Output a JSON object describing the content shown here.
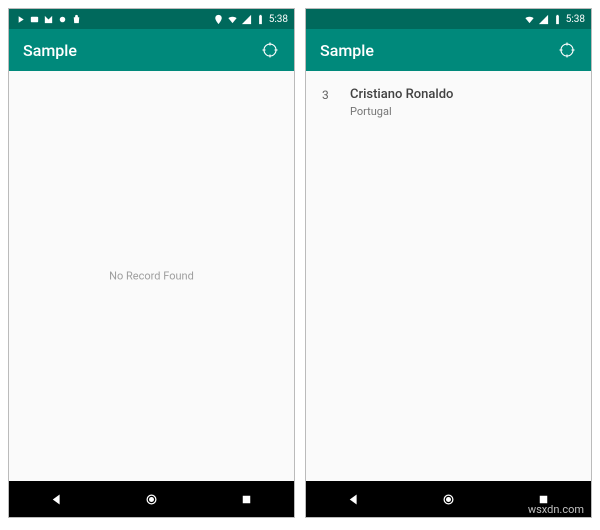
{
  "colors": {
    "primary": "#00897b",
    "primaryDark": "#00695c"
  },
  "status": {
    "time": "5:38"
  },
  "appbar": {
    "title": "Sample"
  },
  "phone1": {
    "emptyMessage": "No Record Found"
  },
  "phone2": {
    "items": [
      {
        "id": "3",
        "name": "Cristiano Ronaldo",
        "country": "Portugal"
      }
    ]
  },
  "watermark": "wsxdn.com"
}
